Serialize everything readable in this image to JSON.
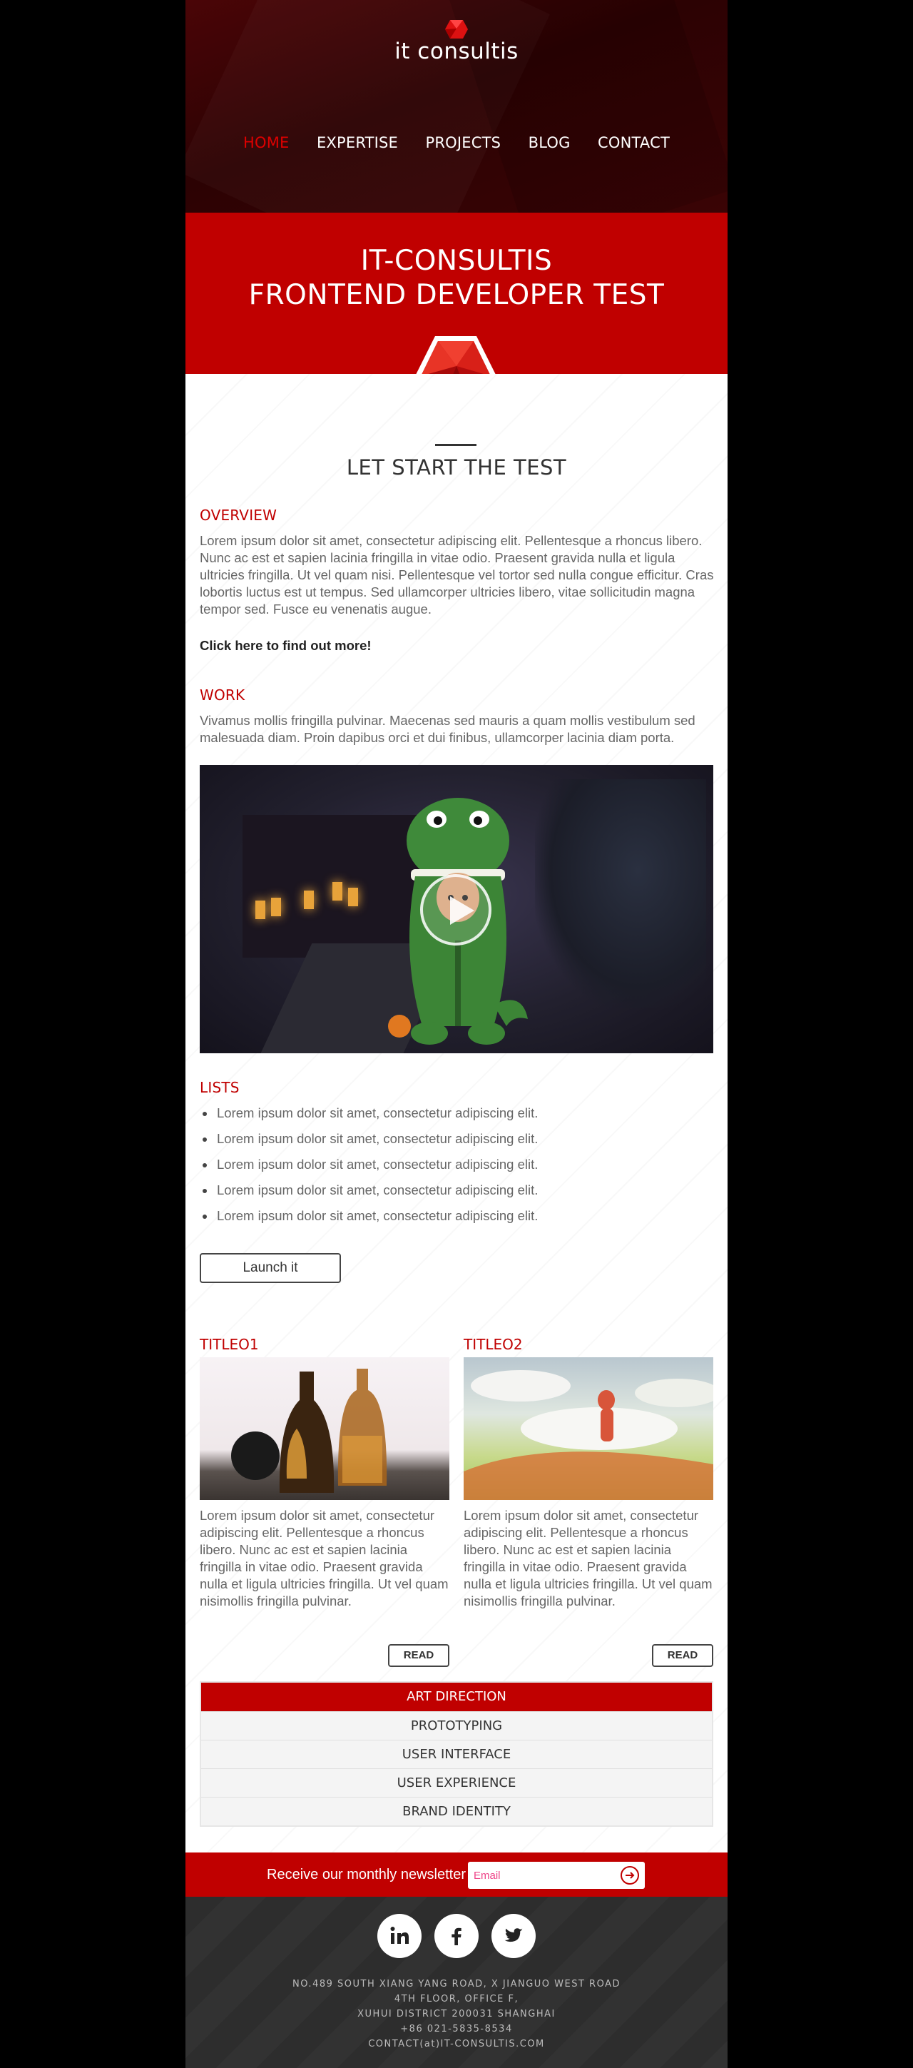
{
  "header": {
    "logo_text": "it consultis",
    "nav": [
      {
        "label": "HOME",
        "active": true
      },
      {
        "label": "EXPERTISE",
        "active": false
      },
      {
        "label": "PROJECTS",
        "active": false
      },
      {
        "label": "BLOG",
        "active": false
      },
      {
        "label": "CONTACT",
        "active": false
      }
    ]
  },
  "hero": {
    "title_line1": "IT-CONSULTIS",
    "title_line2": "FRONTEND DEVELOPER TEST"
  },
  "main": {
    "subtitle": "LET START THE TEST",
    "overview": {
      "title": "OVERVIEW",
      "text": "Lorem ipsum dolor sit amet, consectetur adipiscing elit. Pellentesque a rhoncus libero. Nunc ac est et sapien lacinia fringilla in vitae odio. Praesent gravida nulla et ligula ultricies fringilla. Ut vel quam nisi. Pellentesque vel tortor sed nulla congue efficitur. Cras lobortis luctus est ut tempus. Sed ullamcorper ultricies libero, vitae sollicitudin magna tempor sed. Fusce eu venenatis augue.",
      "link": "Click here to find out more!"
    },
    "work": {
      "title": "WORK",
      "text": "Vivamus mollis fringilla pulvinar. Maecenas sed mauris a quam mollis vestibulum sed malesuada diam. Proin dapibus orci et dui finibus, ullamcorper lacinia diam porta."
    },
    "lists": {
      "title": "LISTS",
      "items": [
        "Lorem ipsum dolor sit amet, consectetur adipiscing elit.",
        "Lorem ipsum dolor sit amet, consectetur adipiscing elit.",
        "Lorem ipsum dolor sit amet, consectetur adipiscing elit.",
        "Lorem ipsum dolor sit amet, consectetur adipiscing elit.",
        "Lorem ipsum dolor sit amet, consectetur adipiscing elit."
      ],
      "button": "Launch it"
    },
    "cards": [
      {
        "title": "TITLEO1",
        "text": "Lorem ipsum dolor sit amet, consectetur adipiscing elit. Pellentesque a rhoncus libero. Nunc ac est et sapien lacinia fringilla in vitae odio. Praesent gravida nulla et ligula ultricies fringilla. Ut vel quam nisimollis fringilla pulvinar.",
        "button": "READ"
      },
      {
        "title": "TITLEO2",
        "text": "Lorem ipsum dolor sit amet, consectetur adipiscing elit. Pellentesque a rhoncus libero. Nunc ac est et sapien lacinia fringilla in vitae odio. Praesent gravida nulla et ligula ultricies fringilla. Ut vel quam nisimollis fringilla pulvinar.",
        "button": "READ"
      }
    ],
    "tabs": [
      "ART DIRECTION",
      "PROTOTYPING",
      "USER INTERFACE",
      "USER EXPERIENCE",
      "BRAND IDENTITY"
    ]
  },
  "newsletter": {
    "label": "Receive our monthly newsletter",
    "placeholder": "Email"
  },
  "footer": {
    "socials": [
      "linkedin-icon",
      "facebook-icon",
      "twitter-icon"
    ],
    "address": [
      "NO.489 SOUTH XIANG YANG ROAD, X JIANGUO WEST ROAD",
      "4TH FLOOR, OFFICE F,",
      "XUHUI DISTRICT 200031 SHANGHAI",
      "+86 021-5835-8534",
      "CONTACT(at)IT-CONSULTIS.COM"
    ]
  },
  "colors": {
    "brand_red": "#c00000",
    "header_dark": "#2c0203",
    "footer_dark": "#2d2d2d"
  }
}
